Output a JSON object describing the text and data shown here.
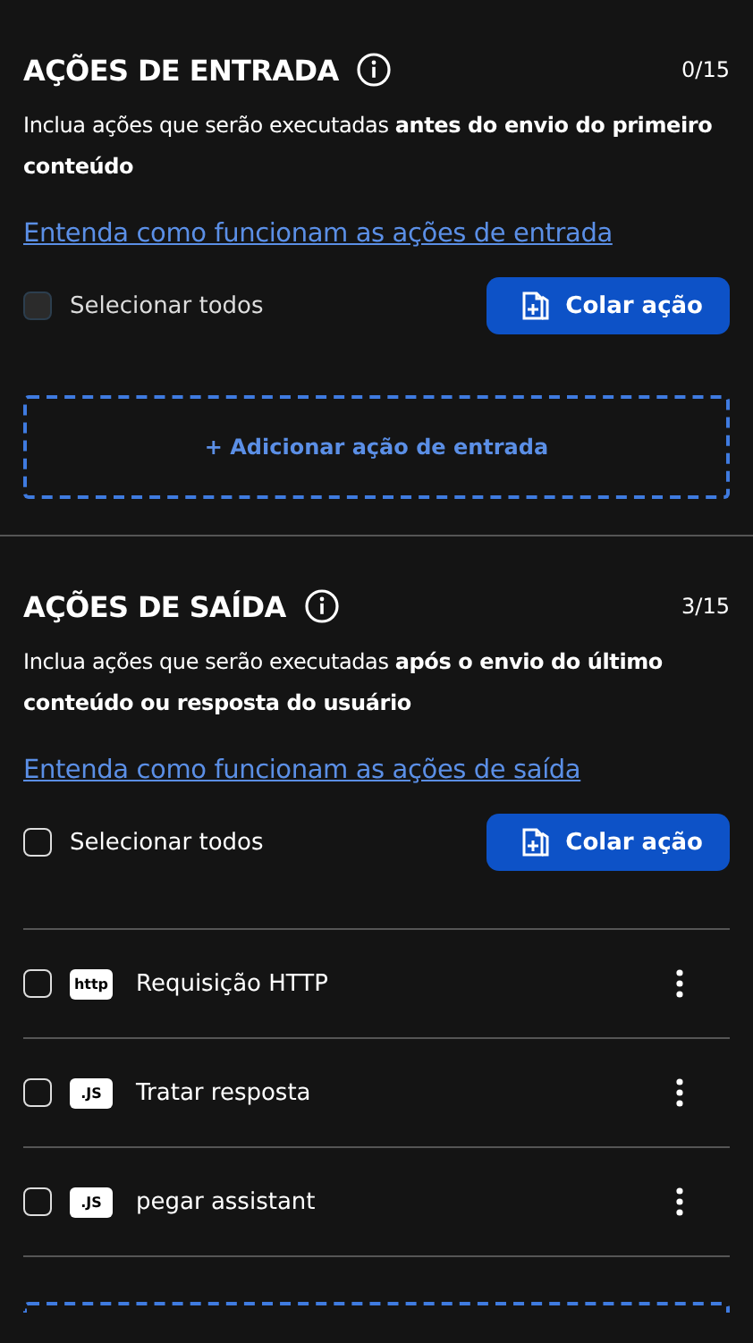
{
  "sections": [
    {
      "title": "AÇÕES DE ENTRADA",
      "count": "0/15",
      "description": "Inclua ações que serão executadas **antes do envio do primeiro conteúdo**",
      "link": "Entenda como funcionam as ações de entrada",
      "select_all": {
        "label": "Selecionar todos",
        "checked": false,
        "disabled": true
      },
      "paste_button": "Colar ação",
      "add_button": {
        "label": "+ Adicionar ação de entrada"
      }
    },
    {
      "title": "AÇÕES DE SAÍDA",
      "count": "3/15",
      "description": "Inclua ações que serão executadas **após o envio do último conteúdo ou resposta do usuário**",
      "link": "Entenda como funcionam as ações de saída",
      "select_all": {
        "label": "Selecionar todos",
        "checked": false,
        "disabled": false
      },
      "paste_button": "Colar ação",
      "actions": [
        {
          "badge": "http",
          "name": "Requisição HTTP",
          "checked": false
        },
        {
          "badge": ".JS",
          "name": "Tratar resposta",
          "checked": false
        },
        {
          "badge": ".JS",
          "name": "pegar assistant",
          "checked": false
        }
      ],
      "add_button_cut_off": true
    }
  ]
}
